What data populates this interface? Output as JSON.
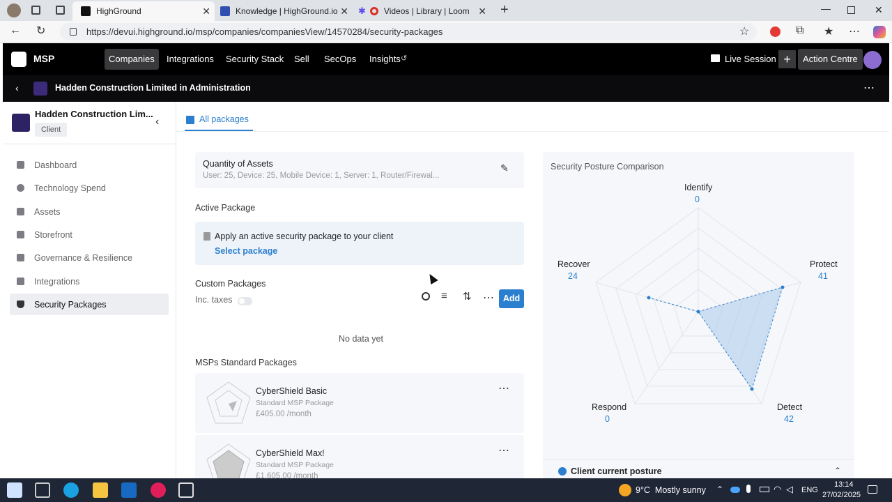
{
  "browser": {
    "tabs": [
      {
        "title": "HighGround",
        "active": true
      },
      {
        "title": "Knowledge | HighGround.io | Inte",
        "active": false
      },
      {
        "title": "Videos | Library | Loom",
        "active": false
      }
    ],
    "url": "https://devui.highground.io/msp/companies/companiesView/14570284/security-packages"
  },
  "topnav": {
    "brand": "MSP",
    "items": [
      "Companies",
      "Integrations",
      "Security Stack",
      "Sell",
      "SecOps",
      "Insights"
    ],
    "live_session": "Live Session",
    "action_centre": "Action Centre"
  },
  "subbar": {
    "client_name": "Hadden Construction Limited in Administration"
  },
  "sidebar": {
    "client_name": "Hadden Construction Lim...",
    "client_badge": "Client",
    "items": [
      {
        "label": "Dashboard"
      },
      {
        "label": "Technology Spend"
      },
      {
        "label": "Assets"
      },
      {
        "label": "Storefront"
      },
      {
        "label": "Governance & Resilience"
      },
      {
        "label": "Integrations"
      },
      {
        "label": "Security Packages",
        "active": true
      }
    ]
  },
  "main": {
    "tab": "All packages",
    "assets": {
      "title": "Quantity of Assets",
      "summary": "User: 25, Device: 25, Mobile Device: 1, Server: 1, Router/Firewal..."
    },
    "active_package": {
      "heading": "Active Package",
      "message": "Apply an active security package to your client",
      "link": "Select package"
    },
    "custom_packages": {
      "heading": "Custom Packages",
      "toggle_label": "Inc. taxes",
      "toggle_on": false,
      "add_label": "Add",
      "empty": "No data yet"
    },
    "standard": {
      "heading": "MSPs Standard Packages",
      "packages": [
        {
          "name": "CyberShield Basic",
          "type": "Standard MSP Package",
          "price": "£405.00 /month"
        },
        {
          "name": "CyberShield Max!",
          "type": "Standard MSP Package",
          "price": "£1,605.00 /month"
        }
      ]
    }
  },
  "posture": {
    "title": "Security Posture Comparison",
    "legend": "Client current posture",
    "axes": [
      {
        "label": "Identify",
        "value": "0"
      },
      {
        "label": "Protect",
        "value": "41"
      },
      {
        "label": "Detect",
        "value": "42"
      },
      {
        "label": "Respond",
        "value": "0"
      },
      {
        "label": "Recover",
        "value": "24"
      }
    ],
    "accent": "#2b7fcf"
  },
  "taskbar": {
    "weather": "9°C  Mostly sunny",
    "lang": "ENG",
    "time": "13:14",
    "date": "27/02/2025"
  }
}
